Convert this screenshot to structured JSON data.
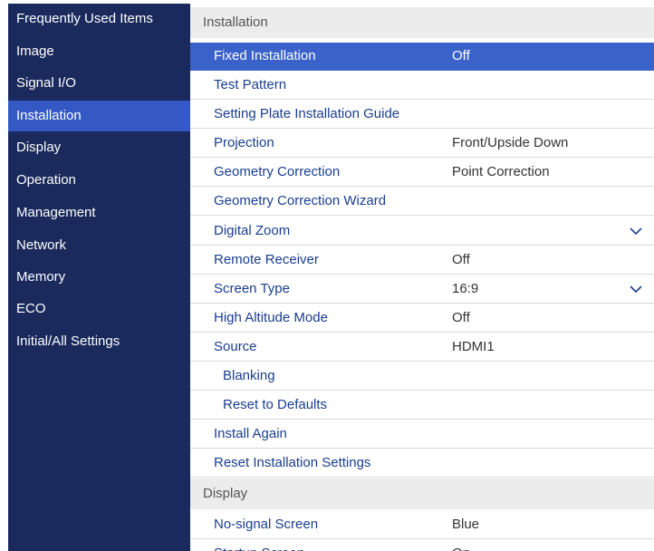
{
  "sidebar": {
    "items": [
      {
        "label": "Frequently Used Items"
      },
      {
        "label": "Image"
      },
      {
        "label": "Signal I/O"
      },
      {
        "label": "Installation",
        "active": true
      },
      {
        "label": "Display"
      },
      {
        "label": "Operation"
      },
      {
        "label": "Management"
      },
      {
        "label": "Network"
      },
      {
        "label": "Memory"
      },
      {
        "label": "ECO"
      },
      {
        "label": "Initial/All Settings"
      }
    ]
  },
  "installation": {
    "header": "Installation",
    "rows": [
      {
        "label": "Fixed Installation",
        "value": "Off",
        "selected": true
      },
      {
        "label": "Test Pattern",
        "value": ""
      },
      {
        "label": "Setting Plate Installation Guide",
        "value": ""
      },
      {
        "label": "Projection",
        "value": "Front/Upside Down"
      },
      {
        "label": "Geometry Correction",
        "value": "Point Correction"
      },
      {
        "label": "Geometry Correction Wizard",
        "value": ""
      },
      {
        "label": "Digital Zoom",
        "value": "",
        "expander": "chevron-down-icon"
      },
      {
        "label": "Remote Receiver",
        "value": "Off"
      },
      {
        "label": "Screen Type",
        "value": "16:9",
        "expander": "chevron-down-icon"
      },
      {
        "label": "High Altitude Mode",
        "value": "Off"
      },
      {
        "label": "Source",
        "value": "HDMI1"
      },
      {
        "label": "Blanking",
        "value": ""
      },
      {
        "label": "Reset to Defaults",
        "value": ""
      },
      {
        "label": "Install Again",
        "value": ""
      },
      {
        "label": "Reset Installation Settings",
        "value": ""
      }
    ]
  },
  "display": {
    "header": "Display",
    "rows": [
      {
        "label": "No-signal Screen",
        "value": "Blue"
      },
      {
        "label": "Startup Screen",
        "value": "On"
      }
    ]
  },
  "colors": {
    "sidebar_bg": "#1a2a5c",
    "active_item_bg": "#3459c4",
    "selected_row_bg": "#3a62c9",
    "row_text": "#1a3e8e"
  }
}
